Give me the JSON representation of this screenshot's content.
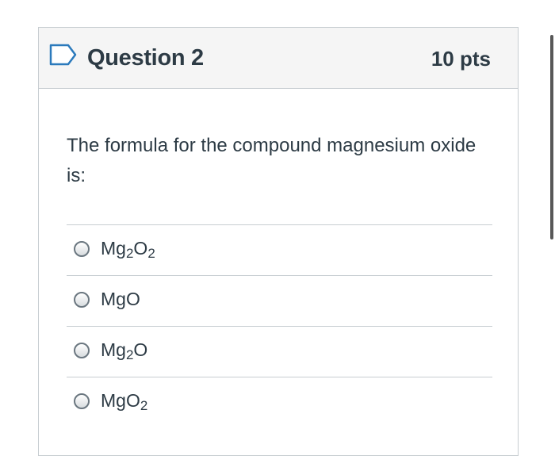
{
  "question": {
    "title": "Question 2",
    "points": "10 pts",
    "flag_icon": "flag-outline-icon",
    "text": "The formula for the compound magnesium oxide is:"
  },
  "answers": [
    {
      "parts": [
        {
          "t": "Mg"
        },
        {
          "s": "2"
        },
        {
          "t": "O"
        },
        {
          "s": "2"
        }
      ]
    },
    {
      "parts": [
        {
          "t": "MgO"
        }
      ]
    },
    {
      "parts": [
        {
          "t": "Mg"
        },
        {
          "s": "2"
        },
        {
          "t": "O"
        }
      ]
    },
    {
      "parts": [
        {
          "t": "MgO"
        },
        {
          "s": "2"
        }
      ]
    }
  ],
  "colors": {
    "text": "#2d3b45",
    "header_bg": "#f5f5f5",
    "border": "#c7cdd1",
    "flag_stroke": "#2b7abc"
  }
}
